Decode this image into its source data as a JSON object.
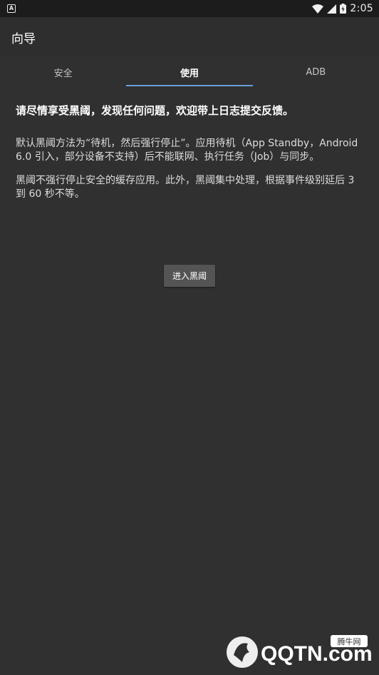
{
  "status_bar": {
    "time": "2:05",
    "notification_icon_letter": "A"
  },
  "app_bar": {
    "title": "向导"
  },
  "tabs": [
    {
      "label": "安全",
      "active": false
    },
    {
      "label": "使用",
      "active": true
    },
    {
      "label": "ADB",
      "active": false
    }
  ],
  "content": {
    "lead": "请尽情享受黑阈，发现任何问题，欢迎带上日志提交反馈。",
    "para1": "默认黑阈方法为“待机，然后强行停止”。应用待机（App Standby，Android 6.0 引入，部分设备不支持）后不能联网、执行任务（Job）与同步。",
    "para2": "黑阈不强行停止安全的缓存应用。此外，黑阈集中处理，根据事件级别延后 3 到 60 秒不等。"
  },
  "enter_button": {
    "label": "进入黑阈"
  },
  "watermark": {
    "brand": "QQTN.com",
    "badge": "腾牛网"
  },
  "colors": {
    "background": "#303030",
    "accent": "#6a9fd8",
    "button": "#545454"
  }
}
